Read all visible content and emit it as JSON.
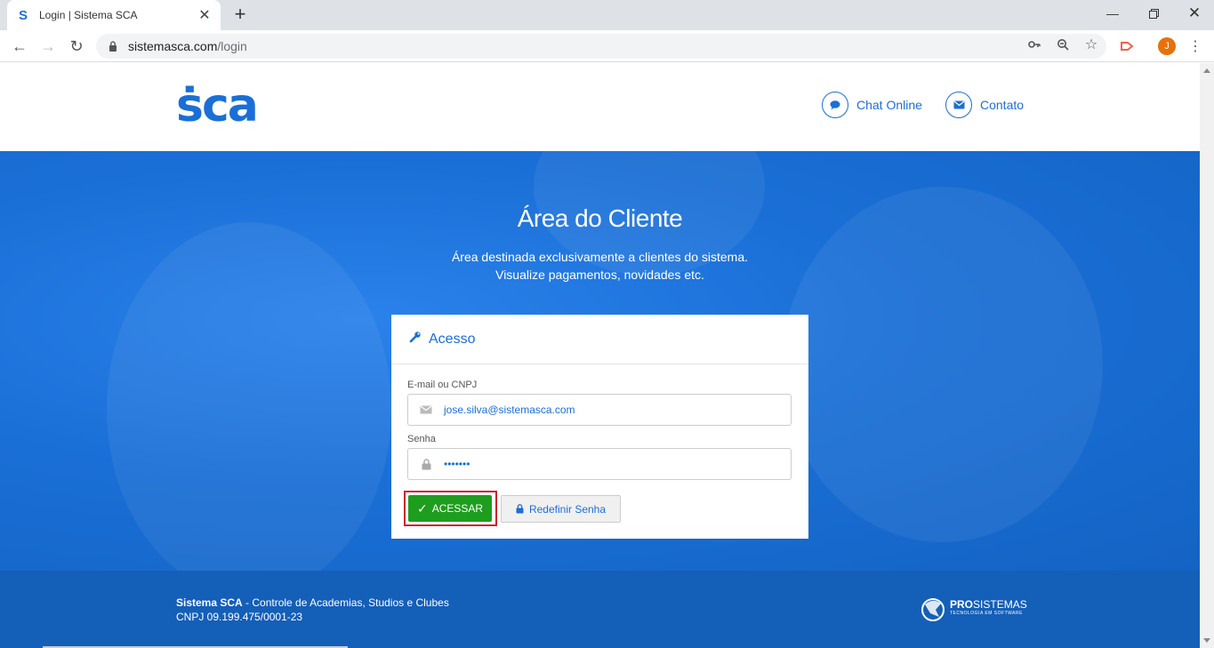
{
  "browser": {
    "tab_title": "Login | Sistema SCA",
    "favicon": "S",
    "url_host": "sistemasca.com",
    "url_path": "/login",
    "avatar_letter": "J"
  },
  "header": {
    "logo_text": "ṡca",
    "chat_label": "Chat Online",
    "contact_label": "Contato"
  },
  "hero": {
    "title": "Área do Cliente",
    "subtitle_line1": "Área destinada exclusivamente a clientes do sistema.",
    "subtitle_line2": "Visualize pagamentos, novidades etc."
  },
  "login": {
    "card_title": "Acesso",
    "email_label": "E-mail ou CNPJ",
    "email_value": "jose.silva@sistemasca.com",
    "password_label": "Senha",
    "password_value": "•••••••",
    "submit_label": "ACESSAR",
    "reset_label": "Redefinir Senha"
  },
  "footer": {
    "brand": "Sistema SCA",
    "description": " - Controle de Academias, Studios e Clubes",
    "cnpj": "CNPJ 09.199.475/0001-23",
    "partner_name_bold": "PRO",
    "partner_name_rest": "SISTEMAS",
    "partner_tagline": "TECNOLOGIA EM SOFTWARE"
  },
  "colors": {
    "brand_blue": "#1a6fd6",
    "submit_green": "#1e9d1e",
    "highlight_red": "#d0232a",
    "footer_blue": "#145fb8"
  }
}
